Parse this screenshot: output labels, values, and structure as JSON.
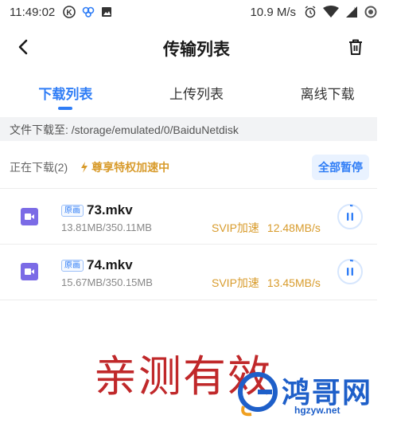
{
  "status_bar": {
    "time": "11:49:02",
    "net_speed": "10.9 M/s",
    "icons": [
      "k-circle-icon",
      "butterfly-icon",
      "image-icon",
      "alarm-icon",
      "wifi-icon",
      "signal-icon",
      "battery-icon"
    ]
  },
  "header": {
    "title": "传输列表",
    "back_icon": "chevron-left-icon",
    "delete_icon": "trash-icon"
  },
  "tabs": [
    {
      "label": "下载列表",
      "active": true
    },
    {
      "label": "上传列表",
      "active": false
    },
    {
      "label": "离线下载",
      "active": false
    }
  ],
  "path_bar": {
    "text": "文件下载至: /storage/emulated/0/BaiduNetdisk"
  },
  "section": {
    "downloading_label": "正在下载(2)",
    "privilege_label": "尊享特权加速中",
    "pause_all_label": "全部暂停"
  },
  "downloads": [
    {
      "badge": "原画",
      "name": "73.mkv",
      "size": "13.81MB/350.11MB",
      "accel_label": "SVIP加速",
      "speed": "12.48MB/s",
      "progress": 0.039
    },
    {
      "badge": "原画",
      "name": "74.mkv",
      "size": "15.67MB/350.15MB",
      "accel_label": "SVIP加速",
      "speed": "13.45MB/s",
      "progress": 0.045
    }
  ],
  "watermark": {
    "text": "亲测有效",
    "logo_text": "鸿哥网",
    "logo_url": "hgzyw.net"
  },
  "colors": {
    "accent": "#2f7df6",
    "gold": "#d89b2b",
    "watermark_red": "#c0282a",
    "video_icon": "#7b6be6"
  }
}
